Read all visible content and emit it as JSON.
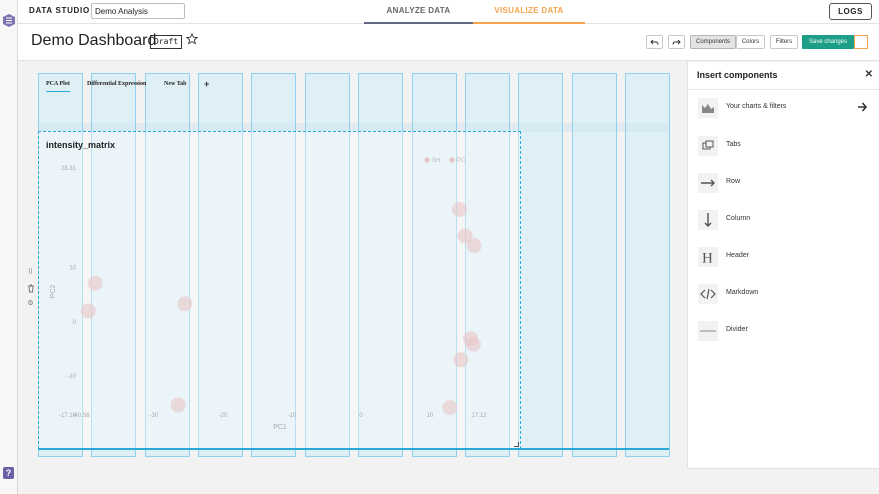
{
  "app": {
    "brand": "DATA STUDIO",
    "dashboard_name_value": "Demo Analysis"
  },
  "nav": {
    "analyze": "ANALYZE DATA",
    "visualize": "VISUALIZE DATA",
    "logs": "LOGS",
    "active_tab": "visualize"
  },
  "header": {
    "title": "Demo Dashboard",
    "status": "Draft",
    "buttons": {
      "components": "Components",
      "colors": "Colors",
      "filters": "Filters",
      "save": "Save changes"
    }
  },
  "colors": {
    "accent_orange": "#f5a44c",
    "save_green": "#1c9e87",
    "grid_blue": "#2aa8d8",
    "nav_underline": "#616a80",
    "help_purple": "#6b5fa6"
  },
  "dashboard_tabs": [
    {
      "label": "PCA Plot",
      "active": true
    },
    {
      "label": "Differential Expression",
      "active": false
    },
    {
      "label": "New Tab",
      "active": false
    }
  ],
  "tab_add_label": "+",
  "chart": {
    "title": "intensity_matrix"
  },
  "chart_data": {
    "type": "scatter",
    "title": "intensity_matrix",
    "xlabel": "PC1",
    "ylabel": "PC2",
    "xlim": [
      -40.56,
      17.12
    ],
    "ylim": [
      -17.16,
      28.31
    ],
    "x_ticks": [
      "-40.56",
      "-30",
      "-20",
      "-10",
      "0",
      "10",
      "17.12"
    ],
    "y_ticks": [
      "28.31",
      "10",
      "0",
      "-10",
      "-17.16"
    ],
    "legend": {
      "placement": "top-right",
      "entries": [
        "SH",
        "PC"
      ]
    },
    "series": [
      {
        "points": [
          {
            "x": -38.5,
            "y": 7.1
          },
          {
            "x": -39.5,
            "y": 2.0
          },
          {
            "x": -25.5,
            "y": 3.3
          },
          {
            "x": -26.5,
            "y": -15.3
          },
          {
            "x": 14.3,
            "y": 20.7
          },
          {
            "x": 15.1,
            "y": 15.8
          },
          {
            "x": 16.4,
            "y": 14.0
          },
          {
            "x": 15.9,
            "y": -3.1
          },
          {
            "x": 14.5,
            "y": -7.0
          },
          {
            "x": 16.3,
            "y": -4.1
          },
          {
            "x": 12.9,
            "y": -15.8
          }
        ]
      }
    ]
  },
  "panel": {
    "title": "Insert components",
    "items": [
      {
        "label": "Your charts & filters",
        "icon": "chart-icon",
        "has_arrow": true
      },
      {
        "label": "Tabs",
        "icon": "tabs-icon"
      },
      {
        "label": "Row",
        "icon": "row-arrow-icon"
      },
      {
        "label": "Column",
        "icon": "column-arrow-icon"
      },
      {
        "label": "Header",
        "icon": "header-h-icon"
      },
      {
        "label": "Markdown",
        "icon": "markdown-code-icon"
      },
      {
        "label": "Divider",
        "icon": "divider-line-icon"
      }
    ]
  }
}
